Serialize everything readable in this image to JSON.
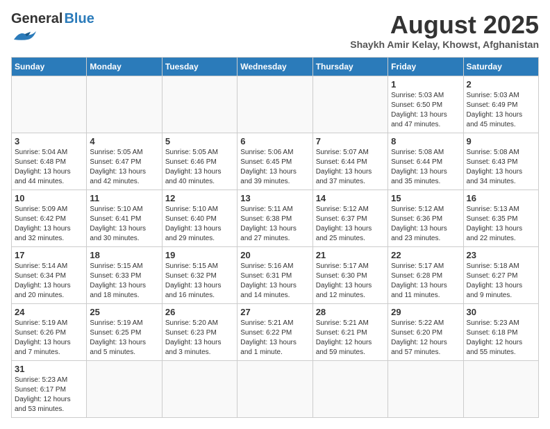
{
  "header": {
    "logo_general": "General",
    "logo_blue": "Blue",
    "title": "August 2025",
    "subtitle": "Shaykh Amir Kelay, Khowst, Afghanistan"
  },
  "days_of_week": [
    "Sunday",
    "Monday",
    "Tuesday",
    "Wednesday",
    "Thursday",
    "Friday",
    "Saturday"
  ],
  "weeks": [
    [
      {
        "day": "",
        "info": ""
      },
      {
        "day": "",
        "info": ""
      },
      {
        "day": "",
        "info": ""
      },
      {
        "day": "",
        "info": ""
      },
      {
        "day": "",
        "info": ""
      },
      {
        "day": "1",
        "info": "Sunrise: 5:03 AM\nSunset: 6:50 PM\nDaylight: 13 hours and 47 minutes."
      },
      {
        "day": "2",
        "info": "Sunrise: 5:03 AM\nSunset: 6:49 PM\nDaylight: 13 hours and 45 minutes."
      }
    ],
    [
      {
        "day": "3",
        "info": "Sunrise: 5:04 AM\nSunset: 6:48 PM\nDaylight: 13 hours and 44 minutes."
      },
      {
        "day": "4",
        "info": "Sunrise: 5:05 AM\nSunset: 6:47 PM\nDaylight: 13 hours and 42 minutes."
      },
      {
        "day": "5",
        "info": "Sunrise: 5:05 AM\nSunset: 6:46 PM\nDaylight: 13 hours and 40 minutes."
      },
      {
        "day": "6",
        "info": "Sunrise: 5:06 AM\nSunset: 6:45 PM\nDaylight: 13 hours and 39 minutes."
      },
      {
        "day": "7",
        "info": "Sunrise: 5:07 AM\nSunset: 6:44 PM\nDaylight: 13 hours and 37 minutes."
      },
      {
        "day": "8",
        "info": "Sunrise: 5:08 AM\nSunset: 6:44 PM\nDaylight: 13 hours and 35 minutes."
      },
      {
        "day": "9",
        "info": "Sunrise: 5:08 AM\nSunset: 6:43 PM\nDaylight: 13 hours and 34 minutes."
      }
    ],
    [
      {
        "day": "10",
        "info": "Sunrise: 5:09 AM\nSunset: 6:42 PM\nDaylight: 13 hours and 32 minutes."
      },
      {
        "day": "11",
        "info": "Sunrise: 5:10 AM\nSunset: 6:41 PM\nDaylight: 13 hours and 30 minutes."
      },
      {
        "day": "12",
        "info": "Sunrise: 5:10 AM\nSunset: 6:40 PM\nDaylight: 13 hours and 29 minutes."
      },
      {
        "day": "13",
        "info": "Sunrise: 5:11 AM\nSunset: 6:38 PM\nDaylight: 13 hours and 27 minutes."
      },
      {
        "day": "14",
        "info": "Sunrise: 5:12 AM\nSunset: 6:37 PM\nDaylight: 13 hours and 25 minutes."
      },
      {
        "day": "15",
        "info": "Sunrise: 5:12 AM\nSunset: 6:36 PM\nDaylight: 13 hours and 23 minutes."
      },
      {
        "day": "16",
        "info": "Sunrise: 5:13 AM\nSunset: 6:35 PM\nDaylight: 13 hours and 22 minutes."
      }
    ],
    [
      {
        "day": "17",
        "info": "Sunrise: 5:14 AM\nSunset: 6:34 PM\nDaylight: 13 hours and 20 minutes."
      },
      {
        "day": "18",
        "info": "Sunrise: 5:15 AM\nSunset: 6:33 PM\nDaylight: 13 hours and 18 minutes."
      },
      {
        "day": "19",
        "info": "Sunrise: 5:15 AM\nSunset: 6:32 PM\nDaylight: 13 hours and 16 minutes."
      },
      {
        "day": "20",
        "info": "Sunrise: 5:16 AM\nSunset: 6:31 PM\nDaylight: 13 hours and 14 minutes."
      },
      {
        "day": "21",
        "info": "Sunrise: 5:17 AM\nSunset: 6:30 PM\nDaylight: 13 hours and 12 minutes."
      },
      {
        "day": "22",
        "info": "Sunrise: 5:17 AM\nSunset: 6:28 PM\nDaylight: 13 hours and 11 minutes."
      },
      {
        "day": "23",
        "info": "Sunrise: 5:18 AM\nSunset: 6:27 PM\nDaylight: 13 hours and 9 minutes."
      }
    ],
    [
      {
        "day": "24",
        "info": "Sunrise: 5:19 AM\nSunset: 6:26 PM\nDaylight: 13 hours and 7 minutes."
      },
      {
        "day": "25",
        "info": "Sunrise: 5:19 AM\nSunset: 6:25 PM\nDaylight: 13 hours and 5 minutes."
      },
      {
        "day": "26",
        "info": "Sunrise: 5:20 AM\nSunset: 6:23 PM\nDaylight: 13 hours and 3 minutes."
      },
      {
        "day": "27",
        "info": "Sunrise: 5:21 AM\nSunset: 6:22 PM\nDaylight: 13 hours and 1 minute."
      },
      {
        "day": "28",
        "info": "Sunrise: 5:21 AM\nSunset: 6:21 PM\nDaylight: 12 hours and 59 minutes."
      },
      {
        "day": "29",
        "info": "Sunrise: 5:22 AM\nSunset: 6:20 PM\nDaylight: 12 hours and 57 minutes."
      },
      {
        "day": "30",
        "info": "Sunrise: 5:23 AM\nSunset: 6:18 PM\nDaylight: 12 hours and 55 minutes."
      }
    ],
    [
      {
        "day": "31",
        "info": "Sunrise: 5:23 AM\nSunset: 6:17 PM\nDaylight: 12 hours and 53 minutes."
      },
      {
        "day": "",
        "info": ""
      },
      {
        "day": "",
        "info": ""
      },
      {
        "day": "",
        "info": ""
      },
      {
        "day": "",
        "info": ""
      },
      {
        "day": "",
        "info": ""
      },
      {
        "day": "",
        "info": ""
      }
    ]
  ]
}
